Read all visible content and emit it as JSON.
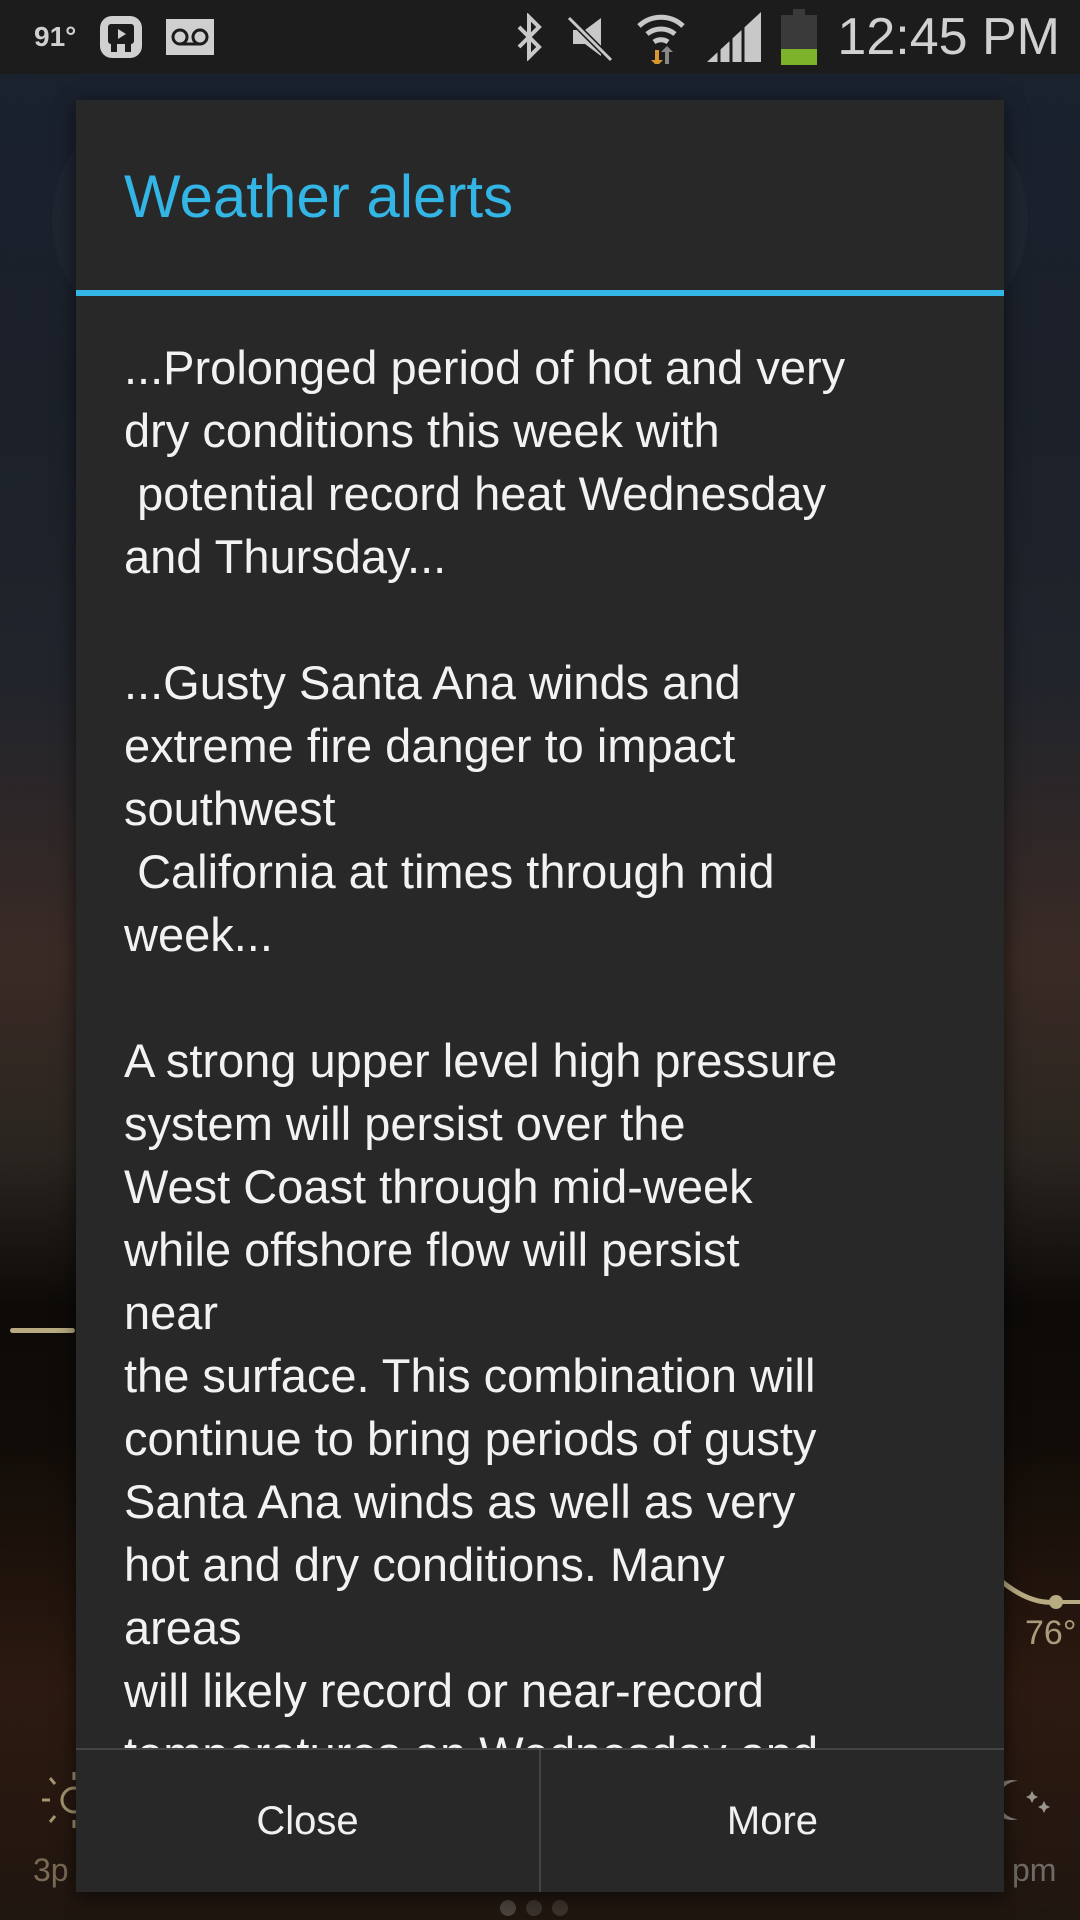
{
  "status_bar": {
    "temperature": "91°",
    "time": "12:45 PM",
    "icons": [
      "app-notification-icon",
      "voicemail-icon",
      "bluetooth-icon",
      "mute-icon",
      "wifi-icon",
      "signal-icon",
      "battery-icon"
    ],
    "battery_level_percent": 30,
    "colors": {
      "battery_fill": "#7cb32a",
      "wifi_download_arrow": "#d9982e"
    }
  },
  "background": {
    "right_temperature": "76°",
    "left_time_label": "3p",
    "right_time_label": "pm"
  },
  "dialog": {
    "title": "Weather alerts",
    "accent_color": "#33b5e5",
    "body": "...Prolonged period of hot and very\ndry conditions this week with\n potential record heat Wednesday\nand Thursday...\n\n...Gusty Santa Ana winds and\nextreme fire danger to impact\nsouthwest\n California at times through mid\nweek...\n\nA strong upper level high pressure\nsystem will persist over the\nWest Coast through mid-week\nwhile offshore flow will persist\nnear\nthe surface. This combination will\ncontinue to bring periods of gusty\nSanta Ana winds as well as very\nhot and dry conditions. Many\nareas\nwill likely record or near-record\ntemperatures on Wednesday and",
    "buttons": {
      "close_label": "Close",
      "more_label": "More"
    }
  }
}
